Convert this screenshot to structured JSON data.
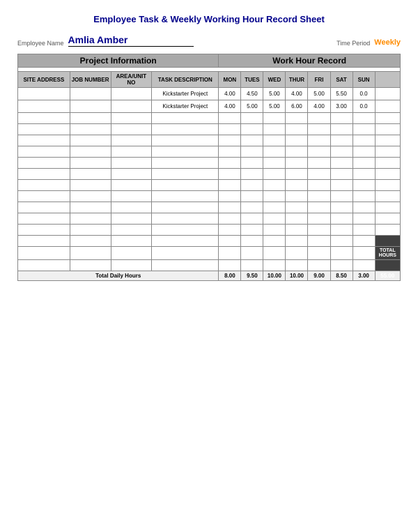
{
  "title": "Employee Task & Weekly Working Hour Record Sheet",
  "employee": {
    "label": "Employee Name",
    "name": "Amlia Amber"
  },
  "timePeriod": {
    "label": "Time Period",
    "value": "Weekly"
  },
  "sections": {
    "projectInfo": "Project Information",
    "workHourRecord": "Work Hour Record"
  },
  "columns": {
    "siteAddress": "SITE ADDRESS",
    "jobNumber": "JOB NUMBER",
    "areaUnit": "AREA/UNIT NO",
    "taskDesc": "TASK DESCRIPTION",
    "mon": "MON",
    "tue": "TUES",
    "wed": "WED",
    "thu": "THUR",
    "fri": "FRI",
    "sat": "SAT",
    "sun": "SUN",
    "totalHours": "TOTAL HOURS"
  },
  "rows": [
    {
      "site": "",
      "job": "",
      "area": "",
      "task": "Kickstarter Project",
      "mon": "4.00",
      "tue": "4.50",
      "wed": "5.00",
      "thu": "4.00",
      "fri": "5.00",
      "sat": "5.50",
      "sun": "0.0",
      "total": ""
    },
    {
      "site": "",
      "job": "",
      "area": "",
      "task": "Kickstarter Project",
      "mon": "4.00",
      "tue": "5.00",
      "wed": "5.00",
      "thu": "6.00",
      "fri": "4.00",
      "sat": "3.00",
      "sun": "0.0",
      "total": ""
    }
  ],
  "emptyRows": 14,
  "totalRow": {
    "label": "Total Daily Hours",
    "mon": "8.00",
    "tue": "9.50",
    "wed": "10.00",
    "thu": "10.00",
    "fri": "9.00",
    "sat": "8.50",
    "sun": "3.00",
    "total": "55.00"
  }
}
